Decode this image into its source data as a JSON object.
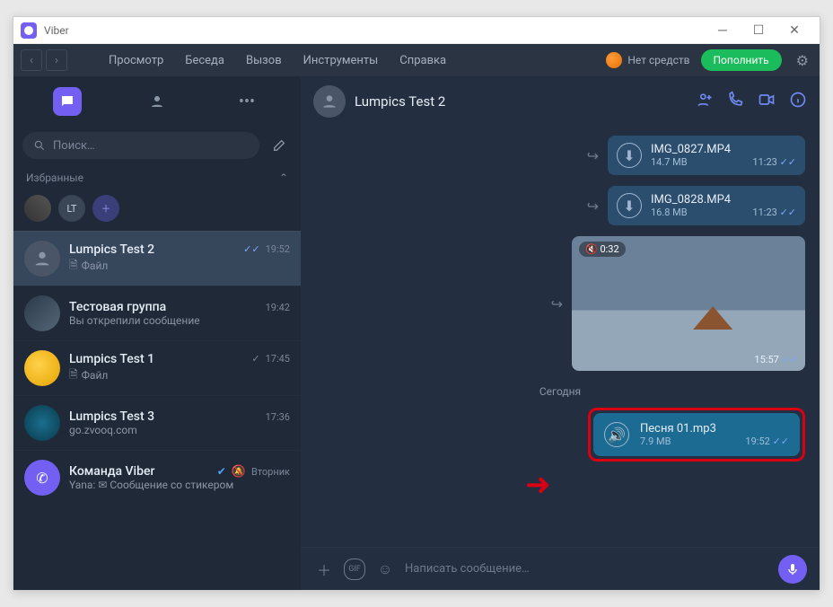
{
  "app_title": "Viber",
  "menu": {
    "view": "Просмотр",
    "chat": "Беседа",
    "call": "Вызов",
    "tools": "Инструменты",
    "help": "Справка"
  },
  "balance_label": "Нет средств",
  "topup_label": "Пополнить",
  "search_placeholder": "Поиск…",
  "favorites_label": "Избранные",
  "fav_initials": "LT",
  "chats": [
    {
      "name": "Lumpics Test 2",
      "sub": "Файл",
      "time": "19:52",
      "read": true,
      "file": true
    },
    {
      "name": "Тестовая группа",
      "sub": "Вы открепили сообщение",
      "time": "19:42"
    },
    {
      "name": "Lumpics Test 1",
      "sub": "Файл",
      "time": "17:45",
      "read": true,
      "file": true
    },
    {
      "name": "Lumpics Test 3",
      "sub": "go.zvooq.com",
      "time": "17:36"
    },
    {
      "name": "Команда Viber",
      "sub": "Yana: ✉ Сообщение со стикером",
      "time": "Вторник",
      "verified": true,
      "muted": true
    }
  ],
  "active_chat": {
    "title": "Lumpics Test 2"
  },
  "msgs": {
    "f1": {
      "name": "IMG_0827.MP4",
      "size": "14.7 MB",
      "time": "11:23"
    },
    "f2": {
      "name": "IMG_0828.MP4",
      "size": "16.8 MB",
      "time": "11:23"
    },
    "video": {
      "dur": "0:32",
      "time": "15:57"
    },
    "date": "Сегодня",
    "audio": {
      "name": "Песня 01.mp3",
      "size": "7.9 MB",
      "time": "19:52"
    }
  },
  "composer_placeholder": "Написать сообщение…",
  "mute_icon": "🔕"
}
